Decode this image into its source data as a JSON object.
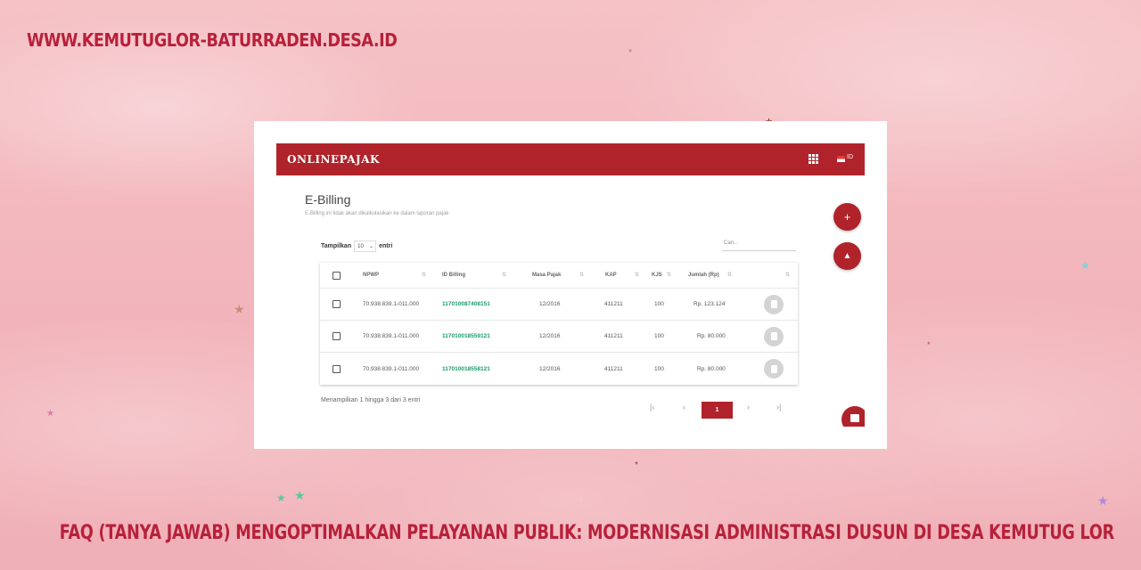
{
  "site_url": "WWW.KEMUTUGLOR-BATURRADEN.DESA.ID",
  "headline": "FAQ (TANYA JAWAB) MENGOPTIMALKAN PELAYANAN PUBLIK: MODERNISASI ADMINISTRASI DUSUN DI DESA KEMUTUG LOR",
  "app": {
    "brand": "ONLINEPAJAK",
    "language": "ID",
    "title": "E-Billing",
    "subtitle": "E-Billing ini tidak akan dikalkulasikan ke dalam laporan pajak",
    "entries_label": "Tampilkan",
    "entries_value": "10",
    "entries_suffix": "entri",
    "search_placeholder": "Cari...",
    "table": {
      "headers": [
        "NPWP",
        "ID Billing",
        "Masa Pajak",
        "KAP",
        "KJS",
        "Jumlah (Rp)"
      ],
      "rows": [
        {
          "npwp": "70.938.839.1-011.000",
          "id_billing": "117010087408151",
          "masa_pajak": "12/2016",
          "kap": "411211",
          "kjs": "100",
          "jumlah": "Rp. 123.124"
        },
        {
          "npwp": "70.938.839.1-011.000",
          "id_billing": "117010018559121",
          "masa_pajak": "12/2016",
          "kap": "411211",
          "kjs": "100",
          "jumlah": "Rp. 80.000"
        },
        {
          "npwp": "70.938.839.1-011.000",
          "id_billing": "117010018558121",
          "masa_pajak": "12/2016",
          "kap": "411211",
          "kjs": "100",
          "jumlah": "Rp. 80.000"
        }
      ]
    },
    "info_text": "Menampilkan 1 hingga 3 dari 3 entri",
    "pagination": {
      "first": "|‹",
      "prev": "‹",
      "current": "1",
      "next": "›",
      "last": "›|"
    },
    "fab_add_icon": "+",
    "fab_upload_icon": "upload-icon"
  },
  "colors": {
    "brand_red": "#b0232a",
    "headline_red": "#b8203a",
    "billing_green": "#1a9c68",
    "background_pink": "#f2b5bb"
  }
}
